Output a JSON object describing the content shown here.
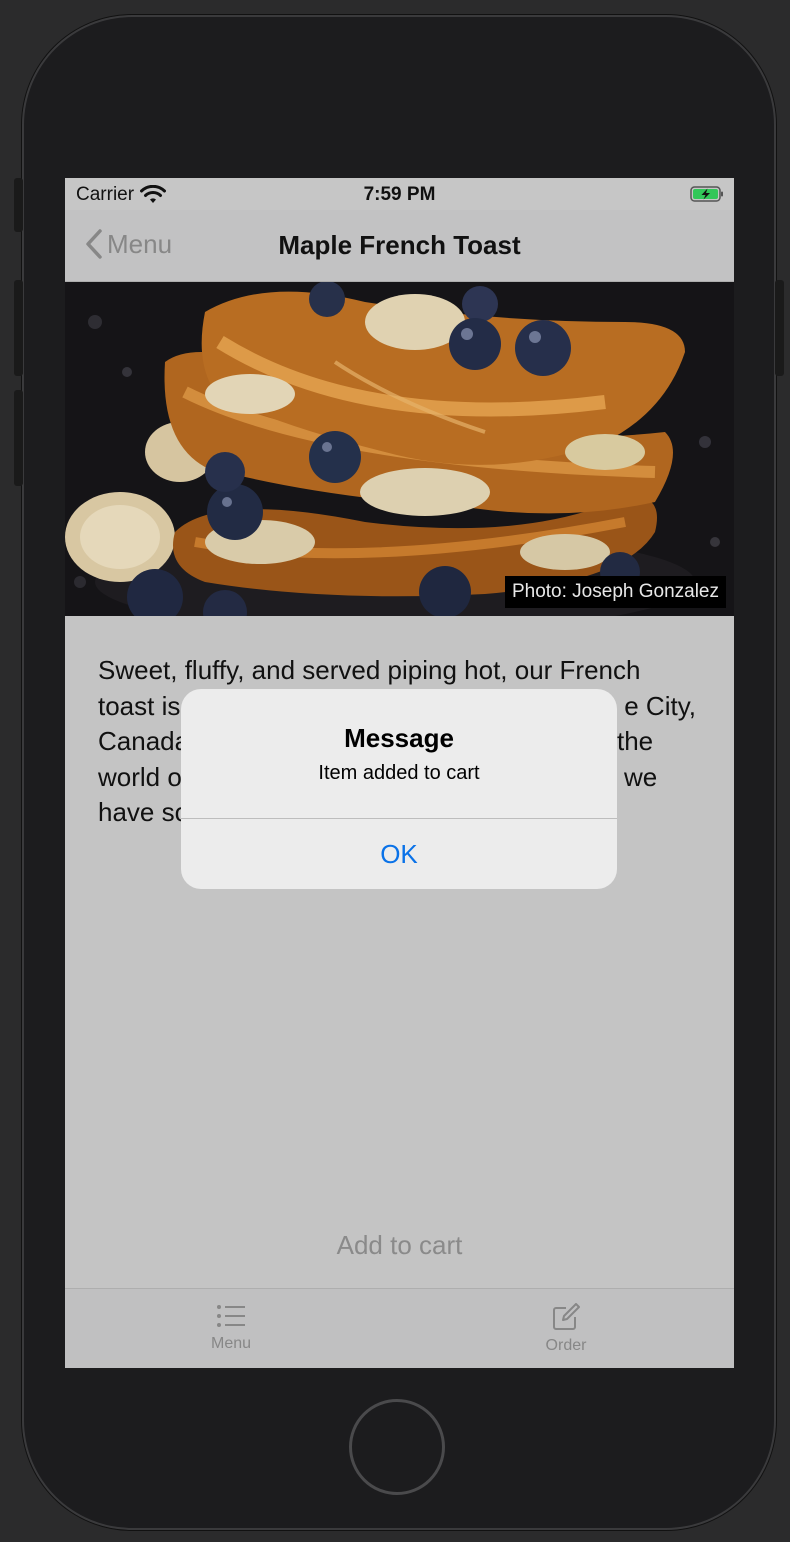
{
  "status_bar": {
    "carrier": "Carrier",
    "time": "7:59 PM"
  },
  "nav": {
    "back_label": "Menu",
    "title": "Maple French Toast"
  },
  "photo": {
    "credit": "Photo: Joseph Gonzalez"
  },
  "description": {
    "line1": "Sweet, fluffy, and served piping hot, our French",
    "line2_start": "toast is",
    "line2_end": "e City,",
    "line3_start": "Canada",
    "line3_end": "the",
    "line4_start": "world o",
    "line4_end": "we",
    "line5_start": "have so"
  },
  "add_to_cart_label": "Add to cart",
  "tabs": [
    {
      "label": "Menu",
      "icon": "list-icon"
    },
    {
      "label": "Order",
      "icon": "compose-icon"
    }
  ],
  "alert": {
    "title": "Message",
    "message": "Item added to cart",
    "ok_label": "OK"
  },
  "colors": {
    "accent_blue": "#0a72e8",
    "dimmed_gray": "#878787",
    "battery_green": "#32c759"
  }
}
